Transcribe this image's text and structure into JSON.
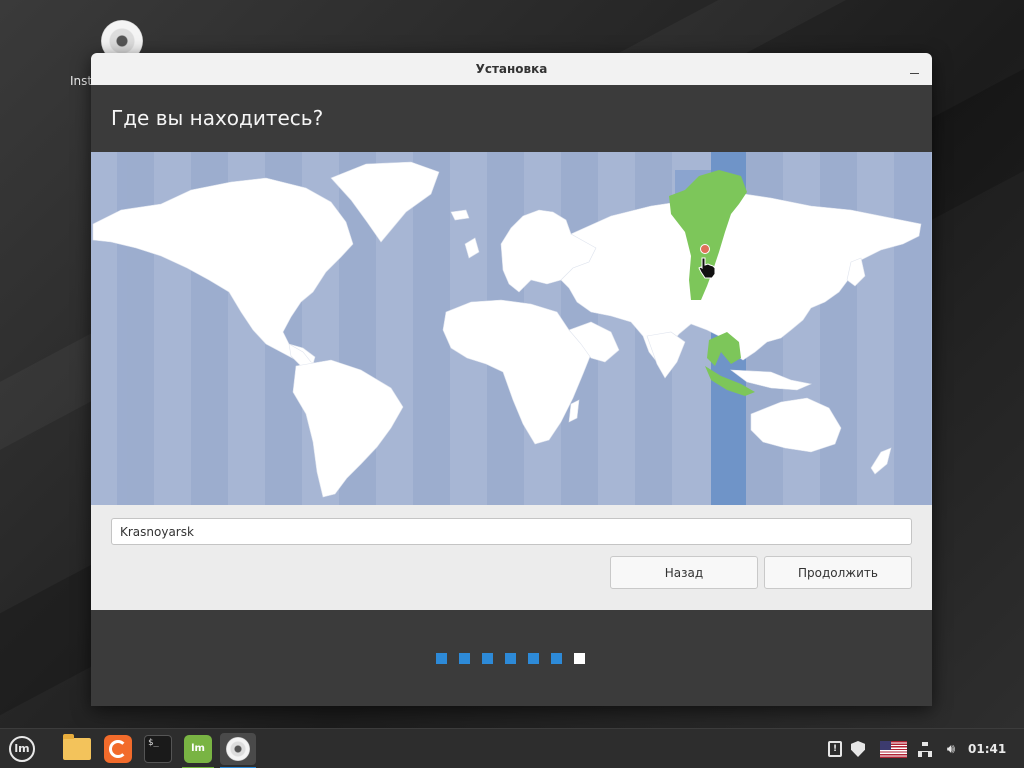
{
  "desktop": {
    "installer_icon_label": "Insta"
  },
  "window": {
    "title": "Установка",
    "heading": "Где вы находитесь?"
  },
  "map": {
    "selected_timezone_color": "#6f94c8",
    "selected_region_color": "#7dc65a",
    "land_color": "#ffffff",
    "ocean_color": "#a7b6d4",
    "pin_color": "#e0705a"
  },
  "location": {
    "value": "Krasnoyarsk"
  },
  "buttons": {
    "back": "Назад",
    "next": "Продолжить"
  },
  "progress": {
    "total_steps": 7,
    "current_step": 7
  },
  "taskbar": {
    "icons": [
      "mint-menu-icon",
      "files-icon",
      "firefox-icon",
      "terminal-icon",
      "mintinstall-icon",
      "installer-icon"
    ],
    "terminal_glyph": "$_",
    "mint_glyph": "lm",
    "clock": "01:41"
  }
}
